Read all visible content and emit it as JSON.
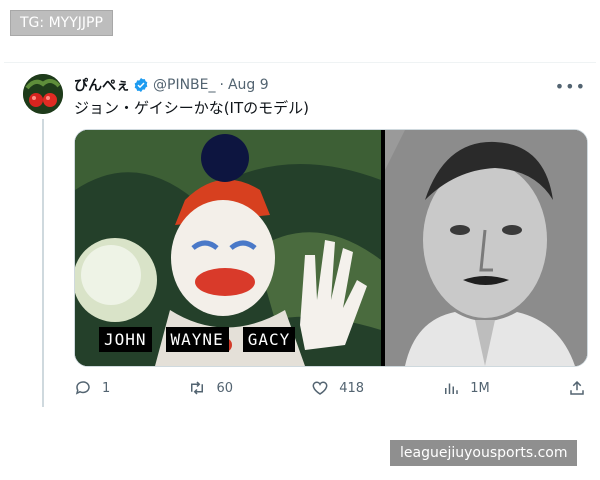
{
  "watermarks": {
    "top": "TG: MYYJJPP",
    "bottom": "leaguejiuyousports.com"
  },
  "tweet": {
    "display_name": "ぴんぺぇ",
    "handle": "@PINBE_",
    "dot": "·",
    "date": "Aug 9",
    "text": "ジョン・ゲイシーかな(ITのモデル)",
    "more_icon": "more-horizontal-icon",
    "media": {
      "caption_words": [
        "JOHN",
        "WAYNE",
        "GACY"
      ]
    },
    "actions": {
      "replies": "1",
      "retweets": "60",
      "likes": "418",
      "views": "1M"
    }
  },
  "colors": {
    "secondary_text": "#536471",
    "verified_blue": "#1d9bf0",
    "border": "#cfd9de"
  }
}
